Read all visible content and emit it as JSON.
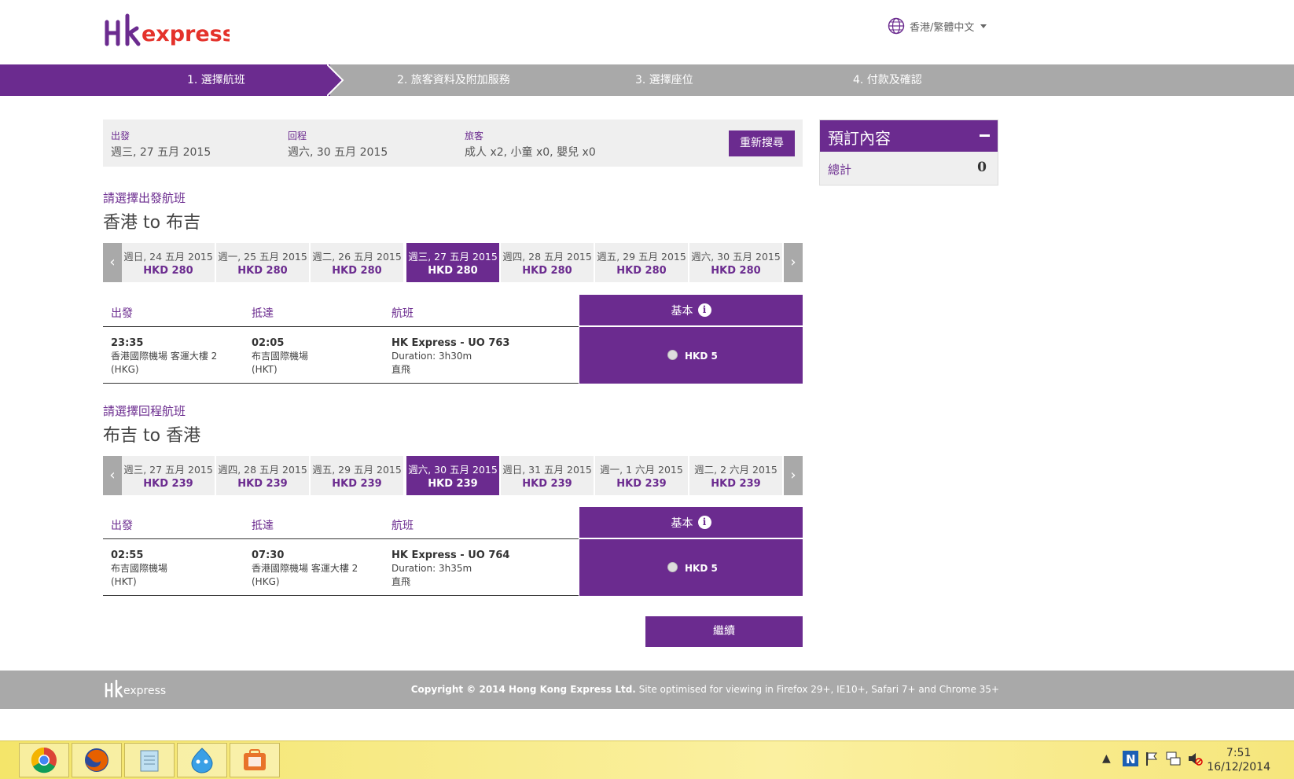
{
  "header": {
    "logo_text": "HKexpress",
    "language": "香港/繁體中文"
  },
  "steps": [
    {
      "label": "1. 選擇航班",
      "active": true
    },
    {
      "label": "2. 旅客資料及附加服務",
      "active": false
    },
    {
      "label": "3. 選擇座位",
      "active": false
    },
    {
      "label": "4. 付款及確認",
      "active": false
    }
  ],
  "search_summary": {
    "depart_label": "出發",
    "depart_value": "週三, 27 五月 2015",
    "return_label": "回程",
    "return_value": "週六, 30 五月 2015",
    "pax_label": "旅客",
    "pax_value": "成人 x2, 小童 x0, 嬰兒 x0",
    "research_button": "重新搜尋"
  },
  "booking_summary": {
    "title": "預訂內容",
    "total_label": "總計",
    "total_value": "0"
  },
  "outbound": {
    "subtitle": "請選擇出發航班",
    "route_from": "香港",
    "route_to_word": "to",
    "route_to": "布吉",
    "dates": [
      {
        "date": "週日, 24 五月 2015",
        "price": "HKD 280"
      },
      {
        "date": "週一, 25 五月 2015",
        "price": "HKD 280"
      },
      {
        "date": "週二, 26 五月 2015",
        "price": "HKD 280"
      },
      {
        "date": "週三, 27 五月 2015",
        "price": "HKD 280"
      },
      {
        "date": "週四, 28 五月 2015",
        "price": "HKD 280"
      },
      {
        "date": "週五, 29 五月 2015",
        "price": "HKD 280"
      },
      {
        "date": "週六, 30 五月 2015",
        "price": "HKD 280"
      }
    ],
    "selected_index": 3,
    "table": {
      "col_depart": "出發",
      "col_arrive": "抵達",
      "col_flight": "航班",
      "fare_type": "基本",
      "depart_time": "23:35",
      "depart_airport": "香港國際機場 客運大樓 2",
      "depart_code": "(HKG)",
      "arrive_time": "02:05",
      "arrive_airport": "布吉國際機場",
      "arrive_code": "(HKT)",
      "flight_no": "HK Express - UO 763",
      "duration": "Duration: 3h30m",
      "stops": "直飛",
      "fare_price": "HKD 5"
    }
  },
  "inbound": {
    "subtitle": "請選擇回程航班",
    "route_from": "布吉",
    "route_to_word": "to",
    "route_to": "香港",
    "dates": [
      {
        "date": "週三, 27 五月 2015",
        "price": "HKD 239"
      },
      {
        "date": "週四, 28 五月 2015",
        "price": "HKD 239"
      },
      {
        "date": "週五, 29 五月 2015",
        "price": "HKD 239"
      },
      {
        "date": "週六, 30 五月 2015",
        "price": "HKD 239"
      },
      {
        "date": "週日, 31 五月 2015",
        "price": "HKD 239"
      },
      {
        "date": "週一, 1 六月 2015",
        "price": "HKD 239"
      },
      {
        "date": "週二, 2 六月 2015",
        "price": "HKD 239"
      }
    ],
    "selected_index": 3,
    "table": {
      "col_depart": "出發",
      "col_arrive": "抵達",
      "col_flight": "航班",
      "fare_type": "基本",
      "depart_time": "02:55",
      "depart_airport": "布吉國際機場",
      "depart_code": "(HKT)",
      "arrive_time": "07:30",
      "arrive_airport": "香港國際機場 客運大樓 2",
      "arrive_code": "(HKG)",
      "flight_no": "HK Express - UO 764",
      "duration": "Duration: 3h35m",
      "stops": "直飛",
      "fare_price": "HKD 5"
    }
  },
  "continue_button": "繼續",
  "footer": {
    "logo_text": "HKexpress",
    "copyright_bold": "Copyright © 2014 Hong Kong Express Ltd.",
    "copyright_rest": " Site optimised for viewing in Firefox 29+, IE10+, Safari 7+ and Chrome 35+"
  },
  "taskbar": {
    "apps": [
      "chrome-icon",
      "firefox-icon",
      "notepad-icon",
      "messenger-icon",
      "office-icon"
    ],
    "time": "7:51",
    "date": "16/12/2014"
  },
  "colors": {
    "brand_purple": "#6b2b8f",
    "step_gray": "#a9a9a9",
    "panel_gray": "#efefef"
  }
}
